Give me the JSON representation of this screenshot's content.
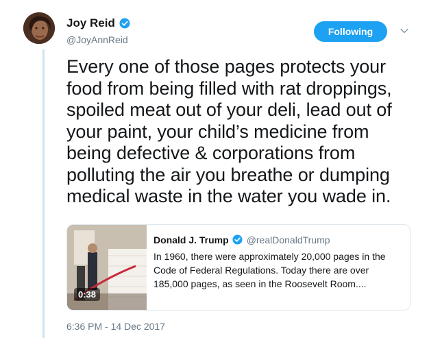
{
  "author": {
    "name": "Joy Reid",
    "handle": "@JoyAnnReid"
  },
  "follow_button": {
    "label": "Following"
  },
  "tweet": {
    "text": "Every one of those pages protects your food from being filled with rat droppings, spoiled meat out of your deli, lead out of your paint, your child’s medicine from being defective & corporations from polluting the air you breathe or dumping medical waste in the water you wade in."
  },
  "quoted_tweet": {
    "name": "Donald J. Trump",
    "handle": "@realDonaldTrump",
    "text": "In 1960, there were approximately 20,000 pages in the Code of Federal Regulations. Today there are over 185,000 pages, as seen in the Roosevelt Room....",
    "video_duration": "0:38"
  },
  "timestamp": "6:36 PM - 14 Dec 2017",
  "colors": {
    "accent": "#1da1f2",
    "secondary_text": "#657786",
    "thread_line": "#cbe4f2"
  },
  "icons": [
    "verified-icon",
    "chevron-down-icon",
    "avatar",
    "video-thumbnail"
  ]
}
